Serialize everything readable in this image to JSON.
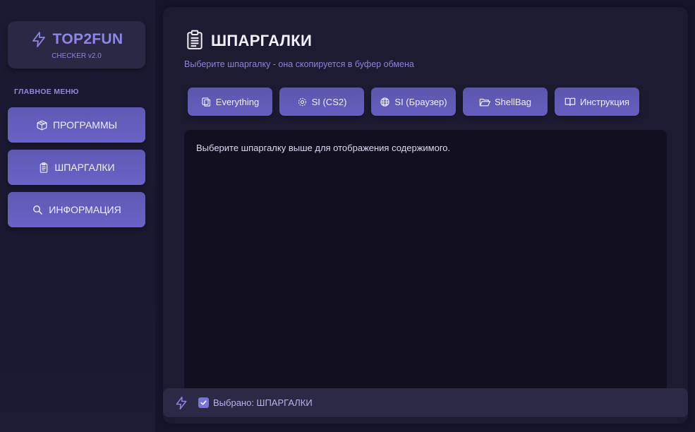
{
  "app": {
    "logo_title": "TOP2FUN",
    "logo_subtitle": "CHECKER v2.0",
    "accent_color": "#6a63c8",
    "logo_color": "#8d86e6"
  },
  "sidebar": {
    "heading": "ГЛАВНОЕ МЕНЮ",
    "items": [
      {
        "label": "ПРОГРАММЫ",
        "icon": "package-icon"
      },
      {
        "label": "ШПАРГАЛКИ",
        "icon": "clipboard-icon"
      },
      {
        "label": "ИНФОРМАЦИЯ",
        "icon": "magnifier-icon"
      }
    ]
  },
  "main": {
    "title": "ШПАРГАЛКИ",
    "title_icon": "clipboard-icon",
    "subtitle": "Выберите шпаргалку - она скопируется в буфер обмена",
    "tabs": [
      {
        "label": "Everything",
        "icon": "copy-icon"
      },
      {
        "label": "SI (CS2)",
        "icon": "gear-icon"
      },
      {
        "label": "SI (Браузер)",
        "icon": "globe-icon"
      },
      {
        "label": "ShellBag",
        "icon": "folder-icon"
      },
      {
        "label": "Инструкция",
        "icon": "book-icon"
      }
    ],
    "content_text": "Выберите шпаргалку выше для отображения содержимого."
  },
  "status": {
    "icon": "lightning-icon",
    "checked": true,
    "text": "Выбрано: ШПАРГАЛКИ"
  }
}
